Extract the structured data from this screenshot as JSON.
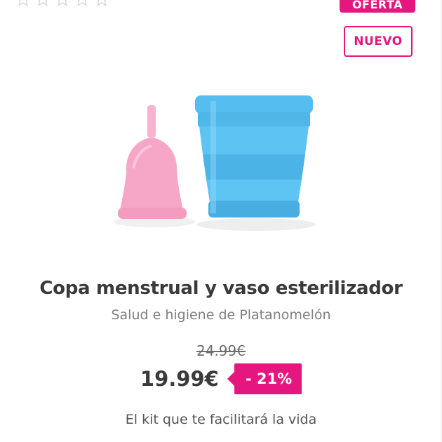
{
  "rating": {
    "stars_filled": 0,
    "stars_total": 5
  },
  "badges": {
    "offer": "OFERTA",
    "new": "NUEVO"
  },
  "product": {
    "image_icon": "menstrual-cup-and-sterilizer-cup-image",
    "title": "Copa menstrual y vaso esterilizador",
    "subtitle": "Salud e higiene de Platanomelón",
    "old_price": "24.99€",
    "price": "19.99€",
    "discount": "- 21%",
    "tagline": "El kit que te facilitará la vida"
  },
  "colors": {
    "accent": "#e5177e",
    "cup": "#f6a7c7",
    "sterilizer": "#4fb8ea"
  }
}
